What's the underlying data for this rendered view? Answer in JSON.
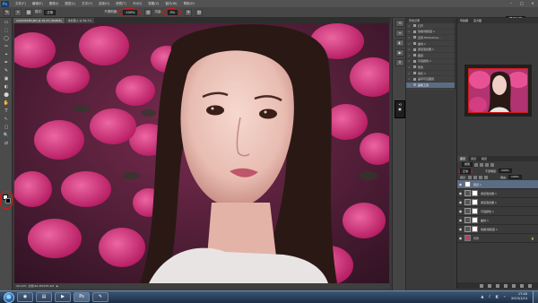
{
  "app": {
    "logo": "Ps",
    "menu": [
      "文件(F)",
      "编辑(E)",
      "图像(I)",
      "图层(L)",
      "文字(Y)",
      "选择(S)",
      "滤镜(T)",
      "3D(D)",
      "视图(V)",
      "窗口(W)",
      "帮助(H)"
    ],
    "window_controls": [
      "–",
      "□",
      "✕"
    ]
  },
  "options_bar": {
    "tool_glyph": "✎",
    "brush_size": "•",
    "mode_label": "模式:",
    "mode_value": "正常",
    "opacity_label": "不透明度:",
    "opacity_value": "100%",
    "flow_label": "流量:",
    "flow_value": "5%",
    "workspace": "基本功能"
  },
  "document": {
    "tabs": [
      "A4A0451B5.JPG @ 16.2% (RGB/8)",
      "未标题-1 @ 66.7%"
    ],
    "status_zoom": "16.19%",
    "status_doc": "文档:62.2M/155.2M"
  },
  "tools": [
    "▭",
    "⬚",
    "◯",
    "✂",
    "⌖",
    "✒",
    "✎",
    "▣",
    "◐",
    "⬤",
    "✋",
    "T",
    "↖",
    "▢",
    "🔍",
    "⇄"
  ],
  "history_panel": {
    "title": "历史记录",
    "items": [
      {
        "label": "打开",
        "selected": false
      },
      {
        "label": "色相/饱和度 1",
        "selected": false
      },
      {
        "label": "应用 Photoshop...",
        "selected": false
      },
      {
        "label": "曲线 1",
        "selected": false
      },
      {
        "label": "通道混合器 1",
        "selected": false
      },
      {
        "label": "图层",
        "selected": false
      },
      {
        "label": "可选颜色 1",
        "selected": false
      },
      {
        "label": "修改",
        "selected": false
      },
      {
        "label": "色阶 1",
        "selected": false
      },
      {
        "label": "盖印可见图层",
        "selected": false
      },
      {
        "label": "色彩平衡",
        "selected": false
      },
      {
        "label": "画笔工具",
        "selected": true
      }
    ]
  },
  "navigator": {
    "tabs": [
      "导航器",
      "直方图"
    ]
  },
  "layers_panel": {
    "tabs": [
      "图层",
      "通道",
      "路径"
    ],
    "kind_label": "类型",
    "blend_mode": "正常",
    "opacity_label": "不透明度:",
    "opacity_value": "100%",
    "lock_label": "锁定:",
    "fill_label": "填充:",
    "fill_value": "100%",
    "layers": [
      {
        "name": "图层 1",
        "thumb": "photo",
        "mask": false,
        "selected": true
      },
      {
        "name": "通道混合器 1",
        "thumb": "adj",
        "mask": true,
        "selected": false
      },
      {
        "name": "通道混合器 1",
        "thumb": "adj",
        "mask": true,
        "selected": false
      },
      {
        "name": "可选颜色 1",
        "thumb": "adj",
        "mask": true,
        "selected": false
      },
      {
        "name": "曲线 1",
        "thumb": "adj",
        "mask": true,
        "selected": false
      },
      {
        "name": "色相/饱和度 1",
        "thumb": "adj",
        "mask": true,
        "selected": false
      },
      {
        "name": "背景",
        "thumb": "photo",
        "mask": false,
        "selected": false
      }
    ]
  },
  "taskbar": {
    "start_glyph": "⊞",
    "apps": [
      {
        "glyph": "◉",
        "active": false
      },
      {
        "glyph": "▤",
        "active": false
      },
      {
        "glyph": "▶",
        "active": false
      },
      {
        "glyph": "Ps",
        "active": true
      },
      {
        "glyph": "✎",
        "active": false
      }
    ],
    "tray_icons": "▲ ♪ ◧ ⌁",
    "time": "17:40",
    "date": "2015/1/14"
  },
  "colors": {
    "accent_red": "#d4191b",
    "selection_blue": "#5b6c84",
    "ps_blue": "#4fa8ff"
  }
}
